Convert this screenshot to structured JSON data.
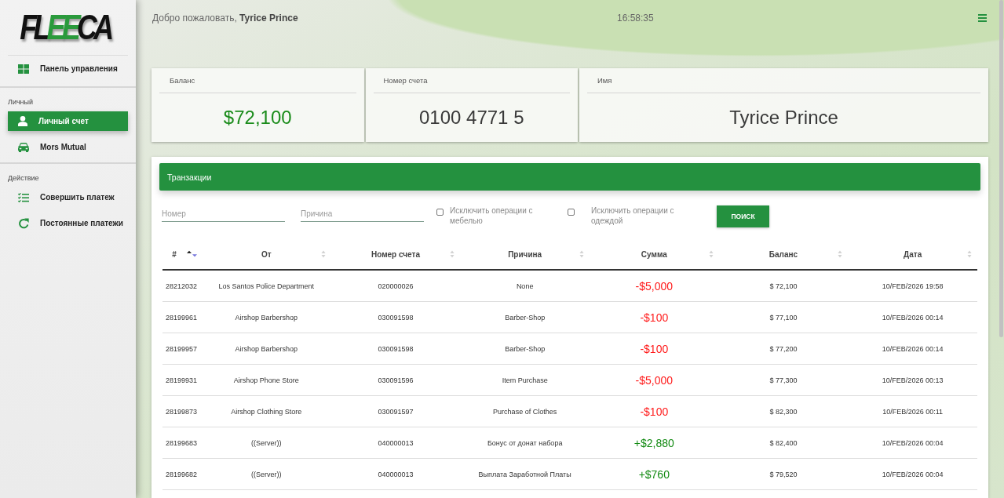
{
  "sidebar": {
    "logo": [
      {
        "text": "FL",
        "kind": "plain"
      },
      {
        "text": "EE",
        "kind": "accent"
      },
      {
        "text": "CA",
        "kind": "plain"
      }
    ],
    "sections": [
      {
        "items": [
          {
            "label": "Панель управления",
            "selected": false
          }
        ]
      },
      {
        "title": "Личный",
        "items": [
          {
            "label": "Личный счет",
            "selected": true
          },
          {
            "label": "Mors Mutual",
            "selected": false
          }
        ]
      },
      {
        "title": "Действие",
        "items": [
          {
            "label": "Совершить платеж",
            "selected": false
          },
          {
            "label": "Постоянные платежи",
            "selected": false
          }
        ]
      }
    ]
  },
  "header": {
    "greeting": "Добро пожаловать, **Tyrice Prince**",
    "time": "16:58:35"
  },
  "cards": [
    {
      "label": "Баланс",
      "value": "$72,100",
      "kind": "amount"
    },
    {
      "label": "Номер счета",
      "value": "0100 4771 5",
      "kind": "text"
    },
    {
      "label": "Имя",
      "value": "Tyrice Prince",
      "kind": "text"
    }
  ],
  "transactions": {
    "title": "Транзакции",
    "fields": [
      {
        "placeholder": "Номер"
      },
      {
        "placeholder": "Причина"
      }
    ],
    "checkboxes": [
      {
        "label": "Исключить операции с мебелью",
        "checked": false
      },
      {
        "label": "Исключить операции с одеждой",
        "checked": false
      }
    ],
    "search_button": "ПОИСК",
    "table": {
      "columns": [
        {
          "label": "#",
          "sorted": true
        },
        {
          "label": "От",
          "sorted": false
        },
        {
          "label": "Номер счета",
          "sorted": false
        },
        {
          "label": "Причина",
          "sorted": false
        },
        {
          "label": "Сумма",
          "sorted": false
        },
        {
          "label": "Баланс",
          "sorted": false
        },
        {
          "label": "Дата",
          "sorted": false
        }
      ],
      "rows": [
        {
          "kind": "debit",
          "id": "28212032",
          "from": "Los Santos Police Department",
          "account": "020000026",
          "reason": "None",
          "amount": "-$5,000",
          "balance": "$ 72,100",
          "date": "10/FEB/2026 19:58"
        },
        {
          "kind": "debit",
          "id": "28199961",
          "from": "Airshop Barbershop",
          "account": "030091598",
          "reason": "Barber-Shop",
          "amount": "-$100",
          "balance": "$ 77,100",
          "date": "10/FEB/2026 00:14"
        },
        {
          "kind": "debit",
          "id": "28199957",
          "from": "Airshop Barbershop",
          "account": "030091598",
          "reason": "Barber-Shop",
          "amount": "-$100",
          "balance": "$ 77,200",
          "date": "10/FEB/2026 00:14"
        },
        {
          "kind": "debit",
          "id": "28199931",
          "from": "Airshop Phone Store",
          "account": "030091596",
          "reason": "Item Purchase",
          "amount": "-$5,000",
          "balance": "$ 77,300",
          "date": "10/FEB/2026 00:13"
        },
        {
          "kind": "debit",
          "id": "28199873",
          "from": "Airshop Clothing Store",
          "account": "030091597",
          "reason": "Purchase of Clothes",
          "amount": "-$100",
          "balance": "$ 82,300",
          "date": "10/FEB/2026 00:11"
        },
        {
          "kind": "credit",
          "id": "28199683",
          "from": "((Server))",
          "account": "040000013",
          "reason": "Бонус от донат набора",
          "amount": "+$2,880",
          "balance": "$ 82,400",
          "date": "10/FEB/2026 00:04"
        },
        {
          "kind": "credit",
          "id": "28199682",
          "from": "((Server))",
          "account": "040000013",
          "reason": "Выплата Заработной Платы",
          "amount": "+$760",
          "balance": "$ 79,520",
          "date": "10/FEB/2026 00:04"
        }
      ]
    }
  }
}
